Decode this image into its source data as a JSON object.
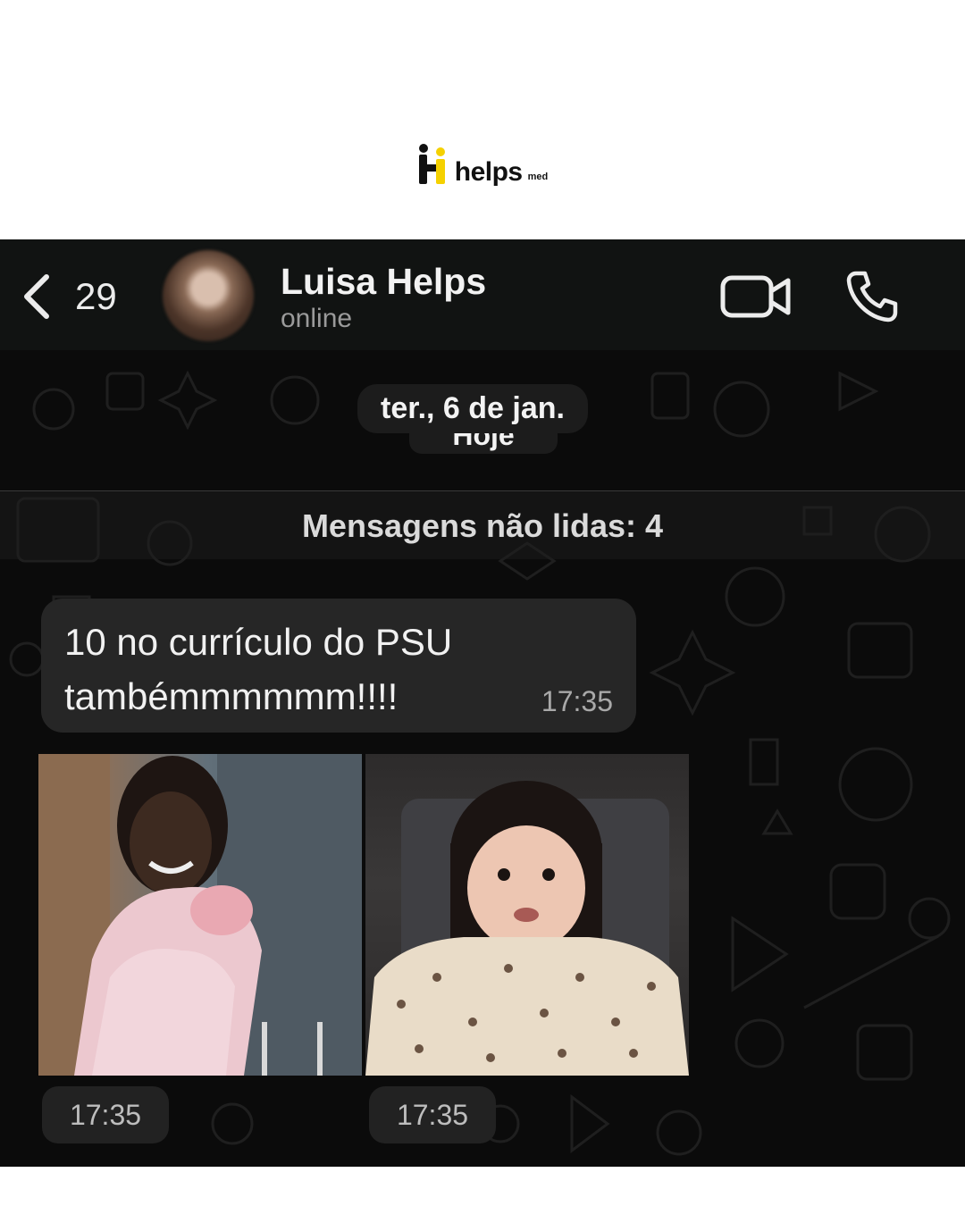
{
  "brand": {
    "wordmark": "helps",
    "suffix": "med",
    "colors": {
      "yellow": "#f5d100",
      "dark": "#111111"
    }
  },
  "topbar": {
    "back_count": "29",
    "contact_name": "Luisa Helps",
    "contact_status": "online",
    "icons": [
      "chevron-left-icon",
      "video-camera-icon",
      "phone-icon"
    ]
  },
  "chat": {
    "date_label": "ter., 6 de jan.",
    "today_label": "Hoje",
    "unread_label": "Mensagens não lidas: 4",
    "messages": [
      {
        "type": "text",
        "text": "10 no currículo do PSU tambémmmmmm!!!!",
        "time": "17:35"
      },
      {
        "type": "image",
        "time": "17:35"
      },
      {
        "type": "image",
        "time": "17:35"
      }
    ]
  }
}
